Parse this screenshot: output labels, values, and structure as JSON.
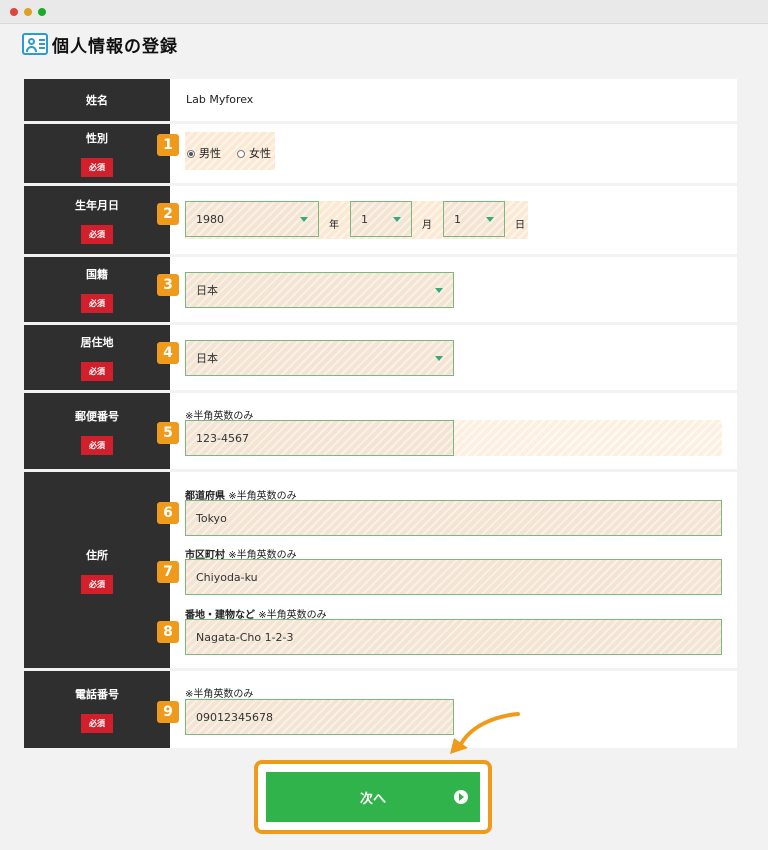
{
  "page": {
    "title": "個人情報の登録"
  },
  "form": {
    "name": {
      "label": "姓名",
      "value": "Lab Myforex"
    },
    "gender": {
      "label": "性別",
      "badge": "1",
      "options": [
        "男性",
        "女性"
      ],
      "selected": "男性"
    },
    "birthdate": {
      "label": "生年月日",
      "badge": "2",
      "year": "1980",
      "year_unit": "年",
      "month": "1",
      "month_unit": "月",
      "day": "1",
      "day_unit": "日"
    },
    "nationality": {
      "label": "国籍",
      "badge": "3",
      "value": "日本"
    },
    "residence": {
      "label": "居住地",
      "badge": "4",
      "value": "日本"
    },
    "postal": {
      "label": "郵便番号",
      "badge": "5",
      "note": "※半角英数のみ",
      "value": "123-4567"
    },
    "address": {
      "label": "住所",
      "prefecture": {
        "badge": "6",
        "label": "都道府県",
        "note": "※半角英数のみ",
        "value": "Tokyo"
      },
      "city": {
        "badge": "7",
        "label": "市区町村",
        "note": "※半角英数のみ",
        "value": "Chiyoda-ku"
      },
      "street": {
        "badge": "8",
        "label": "番地・建物など",
        "note": "※半角英数のみ",
        "value": "Nagata-Cho 1-2-3"
      }
    },
    "phone": {
      "label": "電話番号",
      "badge": "9",
      "note": "※半角英数のみ",
      "value": "09012345678"
    },
    "required_label": "必須"
  },
  "next_button": {
    "label": "次へ"
  },
  "colors": {
    "label_bg": "#2f2f2f",
    "required": "#d21f2c",
    "badge": "#f09a1c",
    "button": "#2fb34a",
    "field_border": "#7bb77e"
  }
}
